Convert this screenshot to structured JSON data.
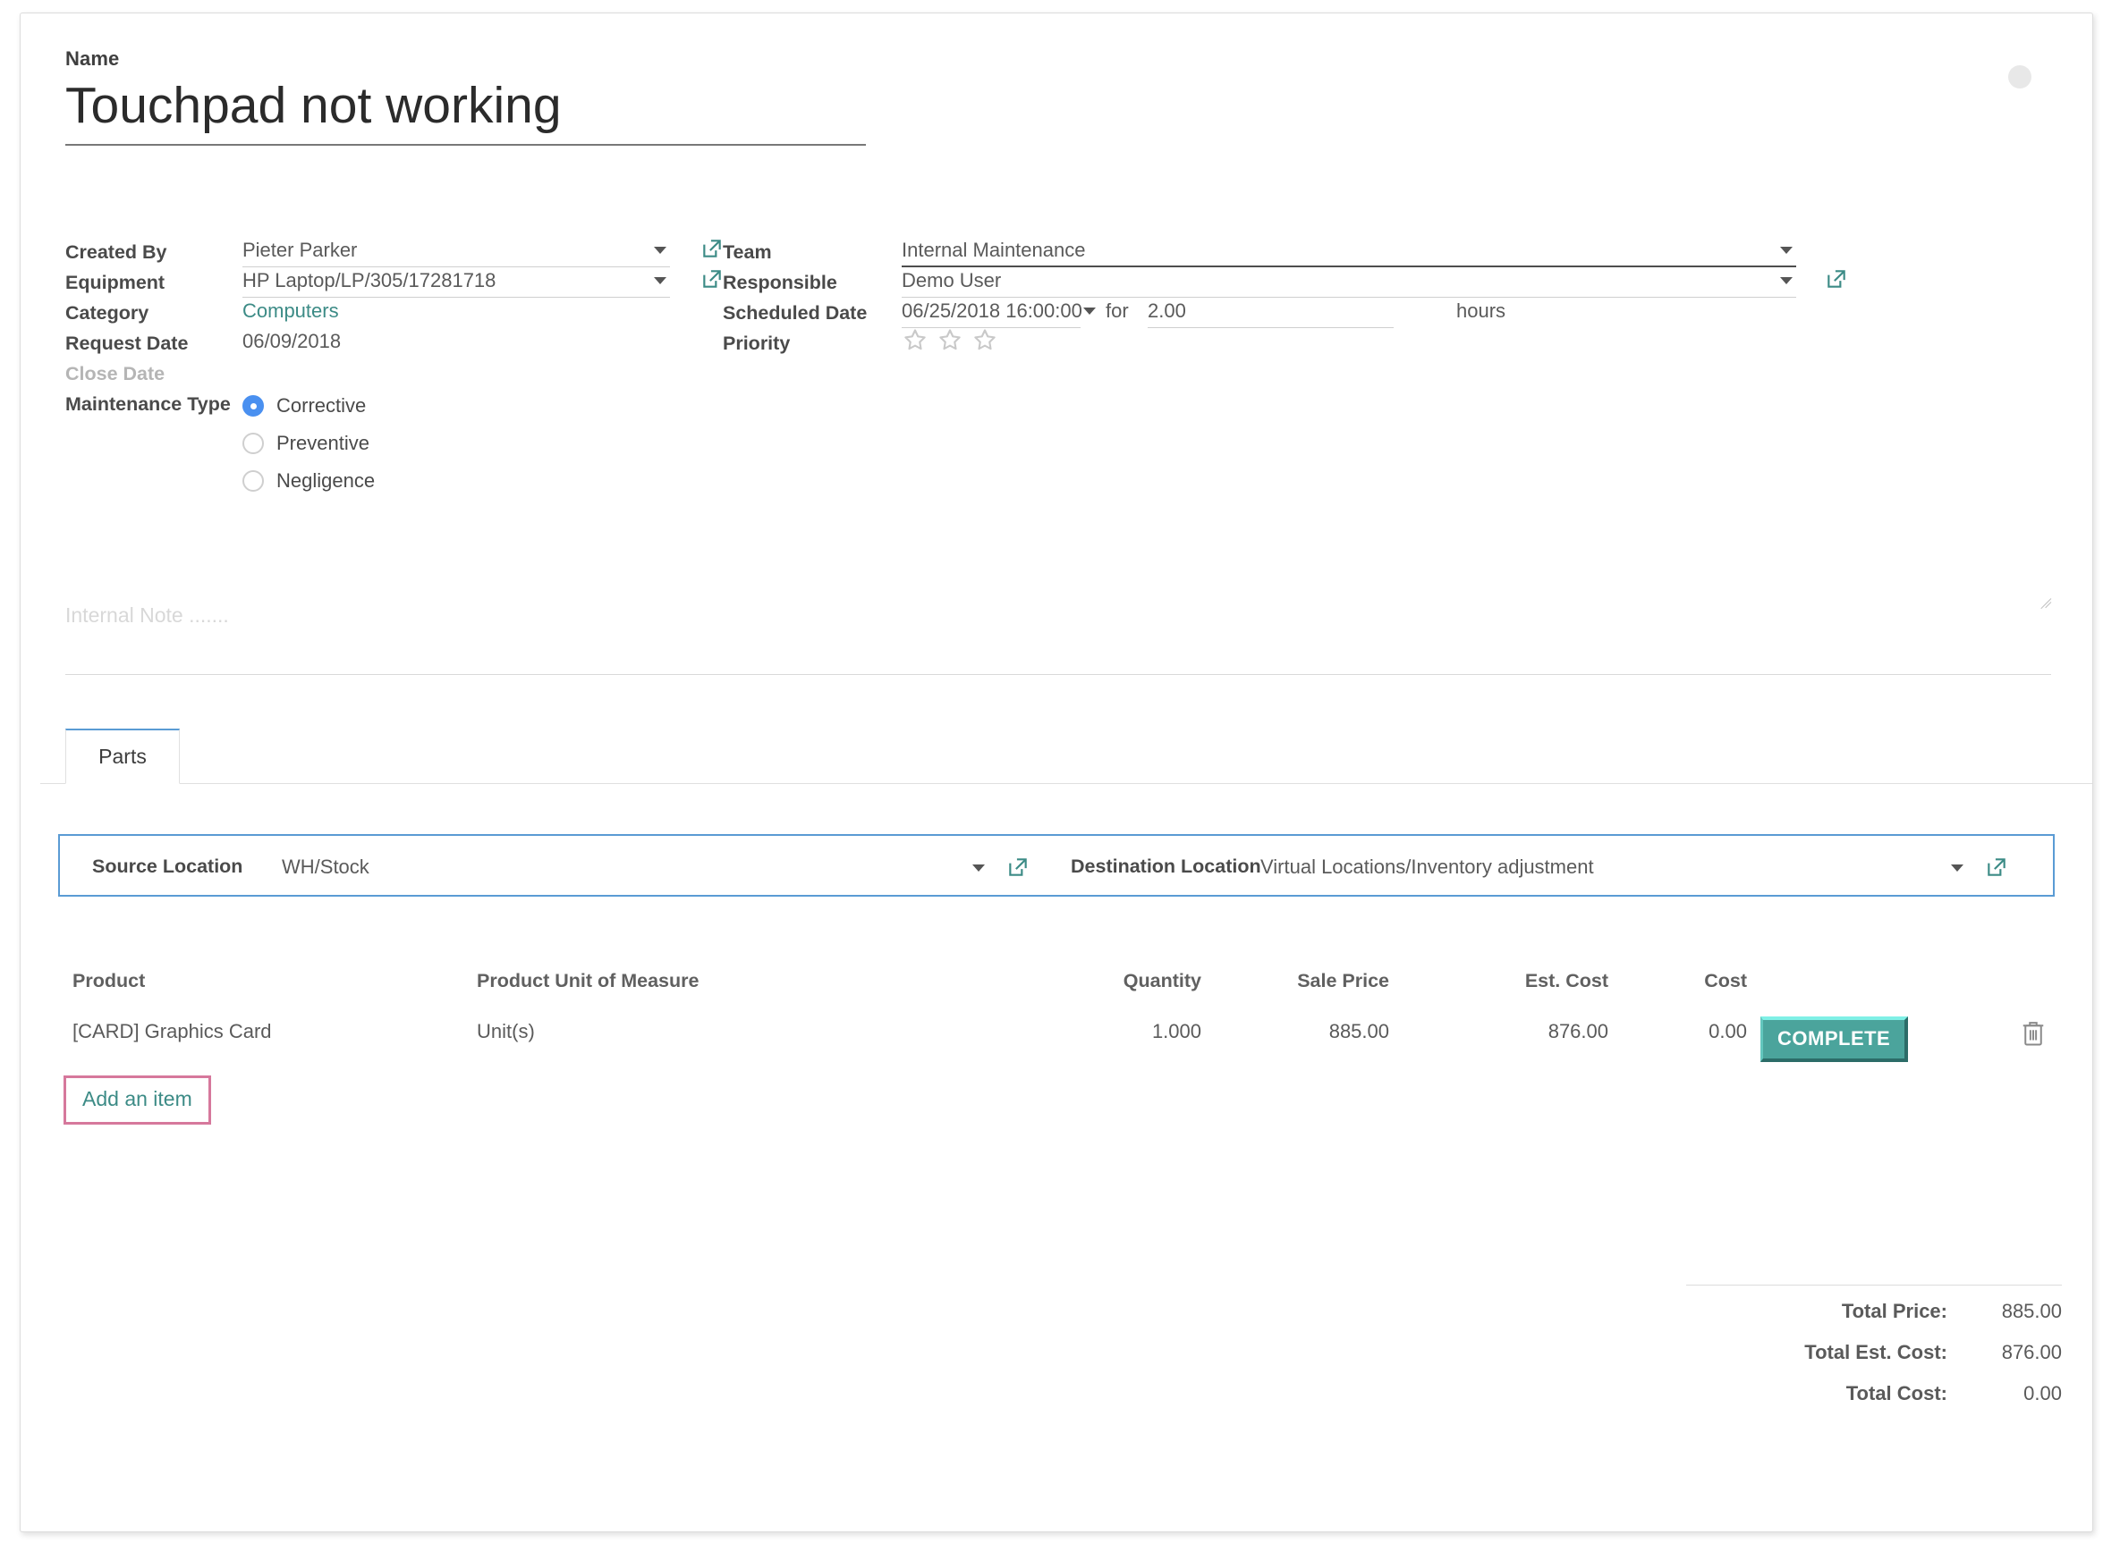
{
  "window": {
    "status_dot": "inactive"
  },
  "record": {
    "name_label": "Name",
    "name_value": "Touchpad not working"
  },
  "form": {
    "left": {
      "created_by": {
        "label": "Created By",
        "value": "Pieter Parker"
      },
      "equipment": {
        "label": "Equipment",
        "value": "HP Laptop/LP/305/17281718"
      },
      "category": {
        "label": "Category",
        "value": "Computers"
      },
      "request_date": {
        "label": "Request Date",
        "value": "06/09/2018"
      },
      "close_date": {
        "label": "Close Date",
        "value": ""
      },
      "maintenance_type": {
        "label": "Maintenance Type",
        "options": [
          "Corrective",
          "Preventive",
          "Negligence"
        ],
        "selected": "Corrective"
      }
    },
    "right": {
      "team": {
        "label": "Team",
        "value": "Internal Maintenance"
      },
      "responsible": {
        "label": "Responsible",
        "value": "Demo User"
      },
      "scheduled_date": {
        "label": "Scheduled Date",
        "value": "06/25/2018 16:00:00",
        "for_word": "for",
        "duration": "2.00",
        "unit": "hours"
      },
      "priority": {
        "label": "Priority",
        "stars_total": 3,
        "stars_filled": 0
      }
    }
  },
  "note": {
    "placeholder": "Internal Note ......."
  },
  "tabs": {
    "items": [
      {
        "label": "Parts",
        "active": true
      }
    ]
  },
  "locations": {
    "source": {
      "label": "Source Location",
      "value": "WH/Stock"
    },
    "destination": {
      "label": "Destination Location",
      "value": "Virtual Locations/Inventory adjustment"
    }
  },
  "parts_table": {
    "columns": [
      "Product",
      "Product Unit of Measure",
      "Quantity",
      "Sale Price",
      "Est. Cost",
      "Cost"
    ],
    "rows": [
      {
        "product": "[CARD] Graphics Card",
        "uom": "Unit(s)",
        "quantity": "1.000",
        "sale_price": "885.00",
        "est_cost": "876.00",
        "cost": "0.00",
        "action_label": "COMPLETE"
      }
    ],
    "add_line_label": "Add an item"
  },
  "totals": [
    {
      "label": "Total Price:",
      "value": "885.00"
    },
    {
      "label": "Total Est. Cost:",
      "value": "876.00"
    },
    {
      "label": "Total Cost:",
      "value": "0.00"
    }
  ],
  "colors": {
    "link_teal": "#3c8b86",
    "radio_blue": "#4a90f0",
    "tab_accent": "#5a9bd4",
    "highlight_border": "#5a9bd4",
    "badge_teal": "#4ba49c",
    "add_item_border": "#d6789c"
  }
}
